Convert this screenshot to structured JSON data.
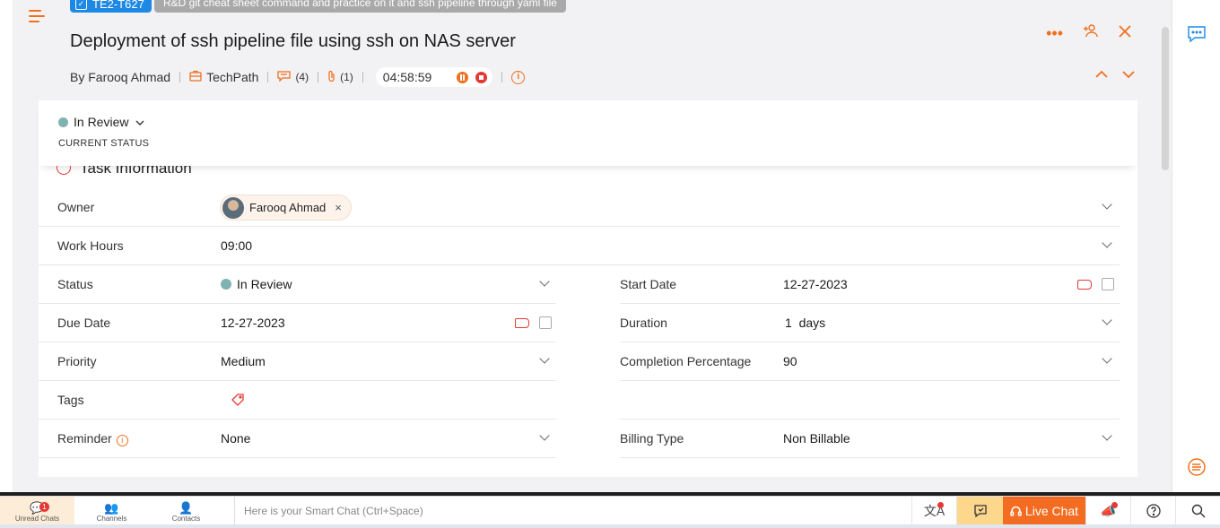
{
  "task": {
    "id": "TE2-T627",
    "parent_tag": "R&D git cheat sheet command and practice on it and ssh pipeline through yaml file",
    "title": "Deployment of ssh pipeline file using ssh on NAS server"
  },
  "meta": {
    "by_label": "By Farooq Ahmad",
    "project": "TechPath",
    "comments_count": "(4)",
    "attachments_count": "(1)",
    "timer": "04:58:59"
  },
  "status_header": {
    "value": "In Review",
    "caption": "CURRENT STATUS",
    "status_color": "#7fb3b1"
  },
  "section": {
    "title": "Task Information"
  },
  "fields": {
    "owner": {
      "label": "Owner",
      "value": "Farooq Ahmad"
    },
    "work_hours": {
      "label": "Work Hours",
      "value": "09:00"
    },
    "status": {
      "label": "Status",
      "value": "In Review"
    },
    "start_date": {
      "label": "Start Date",
      "value": "12-27-2023"
    },
    "due_date": {
      "label": "Due Date",
      "value": "12-27-2023"
    },
    "duration": {
      "label": "Duration",
      "value": "1  days"
    },
    "priority": {
      "label": "Priority",
      "value": "Medium"
    },
    "completion": {
      "label": "Completion Percentage",
      "value": "90"
    },
    "tags": {
      "label": "Tags"
    },
    "reminder": {
      "label": "Reminder",
      "value": "None"
    },
    "billing_type": {
      "label": "Billing Type",
      "value": "Non Billable"
    }
  },
  "bottom_bar": {
    "tabs": [
      {
        "label": "Unread Chats",
        "badge": "1",
        "icon": "chat-bubbles-icon"
      },
      {
        "label": "Channels",
        "icon": "channels-icon"
      },
      {
        "label": "Contacts",
        "icon": "contacts-icon"
      }
    ],
    "smart_chat_placeholder": "Here is your Smart Chat (Ctrl+Space)",
    "live_chat_label": "Live Chat"
  },
  "colors": {
    "accent": "#f0701e",
    "id_badge": "#1e88e5",
    "live_chat": "#f36c22"
  }
}
